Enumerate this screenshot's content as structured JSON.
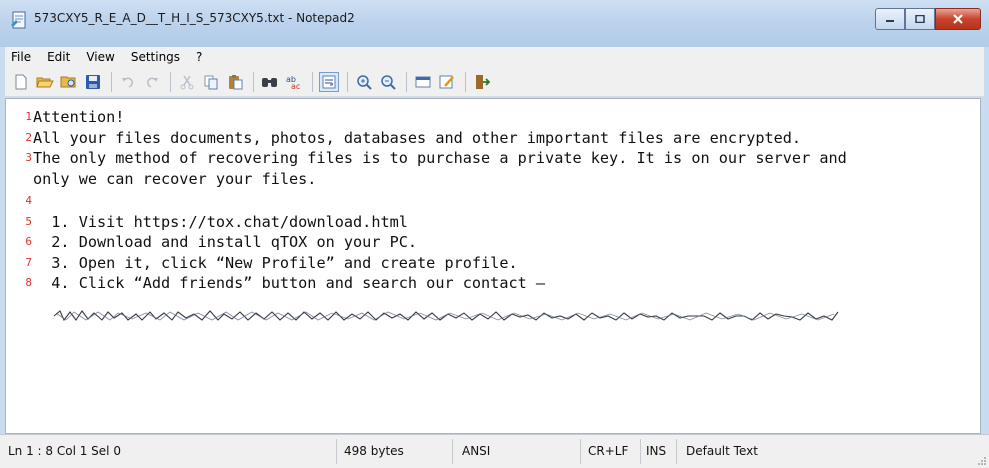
{
  "window": {
    "title": "573CXY5_R_E_A_D__T_H_I_S_573CXY5.txt - Notepad2"
  },
  "menu": {
    "items": [
      "File",
      "Edit",
      "View",
      "Settings",
      "?"
    ]
  },
  "toolbar": {
    "icons": [
      "new-file-icon",
      "open-folder-icon",
      "browse-icon",
      "save-icon",
      "undo-icon",
      "redo-icon",
      "cut-icon",
      "copy-icon",
      "paste-icon",
      "find-icon",
      "replace-icon",
      "word-wrap-icon",
      "zoom-in-icon",
      "zoom-out-icon",
      "view-icon",
      "scheme-icon",
      "exit-icon"
    ]
  },
  "editor": {
    "lines": [
      {
        "num": "1",
        "text": "Attention!"
      },
      {
        "num": "2",
        "text": "All your files documents, photos, databases and other important files are encrypted."
      },
      {
        "num": "3",
        "text": "The only method of recovering files is to purchase a private key. It is on our server and"
      },
      {
        "num": "",
        "text": "only we can recover your files."
      },
      {
        "num": "4",
        "text": ""
      },
      {
        "num": "5",
        "text": "  1. Visit https://tox.chat/download.html"
      },
      {
        "num": "6",
        "text": "  2. Download and install qTOX on your PC."
      },
      {
        "num": "7",
        "text": "  3. Open it, click “New Profile” and create profile."
      },
      {
        "num": "8",
        "text": "  4. Click “Add friends” button and search our contact –"
      }
    ]
  },
  "statusbar": {
    "position": "Ln 1 : 8   Col 1   Sel 0",
    "size": "498 bytes",
    "encoding": "ANSI",
    "eol": "CR+LF",
    "mode": "INS",
    "scheme": "Default Text"
  },
  "colors": {
    "line_number": "#e0302a",
    "title_bar": "#bcd3ec",
    "close_button": "#c8432c"
  }
}
